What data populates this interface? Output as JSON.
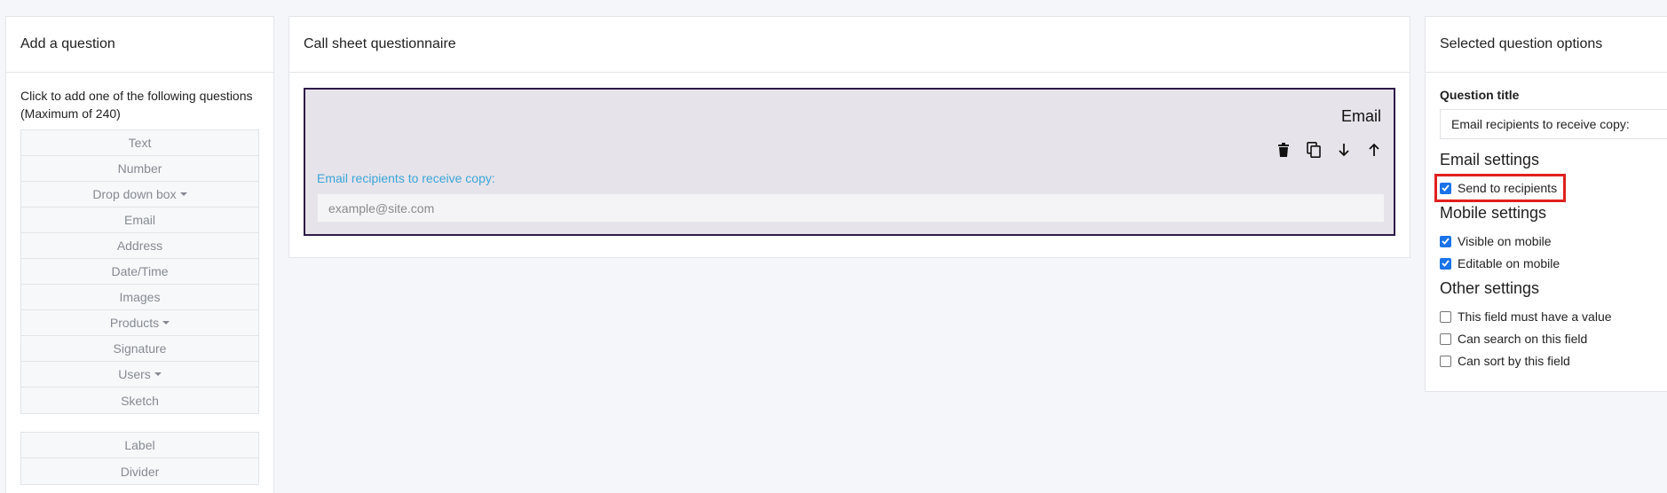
{
  "left_panel": {
    "title": "Add a question",
    "intro": "Click to add one of the following questions (Maximum of 240)",
    "questions": [
      {
        "label": "Text",
        "dropdown": false
      },
      {
        "label": "Number",
        "dropdown": false
      },
      {
        "label": "Drop down box",
        "dropdown": true
      },
      {
        "label": "Email",
        "dropdown": false
      },
      {
        "label": "Address",
        "dropdown": false
      },
      {
        "label": "Date/Time",
        "dropdown": false
      },
      {
        "label": "Images",
        "dropdown": false
      },
      {
        "label": "Products",
        "dropdown": true
      },
      {
        "label": "Signature",
        "dropdown": false
      },
      {
        "label": "Users",
        "dropdown": true
      },
      {
        "label": "Sketch",
        "dropdown": false
      }
    ],
    "extras": [
      {
        "label": "Label"
      },
      {
        "label": "Divider"
      }
    ]
  },
  "middle_panel": {
    "title": "Call sheet questionnaire",
    "question": {
      "type": "Email",
      "label": "Email recipients to receive copy:",
      "placeholder": "example@site.com",
      "tools": [
        "trash-icon",
        "copy-icon",
        "arrow-down-icon",
        "arrow-up-icon"
      ]
    }
  },
  "right_panel": {
    "title": "Selected question options",
    "question_title_label": "Question title",
    "question_title_value": "Email recipients to receive copy:",
    "email_settings": {
      "heading": "Email settings",
      "send_to_recipients": {
        "label": "Send to recipients",
        "checked": true
      }
    },
    "mobile_settings": {
      "heading": "Mobile settings",
      "visible": {
        "label": "Visible on mobile",
        "checked": true
      },
      "editable": {
        "label": "Editable on mobile",
        "checked": true
      }
    },
    "other_settings": {
      "heading": "Other settings",
      "required": {
        "label": "This field must have a value",
        "checked": false
      },
      "searchable": {
        "label": "Can search on this field",
        "checked": false
      },
      "sortable": {
        "label": "Can sort by this field",
        "checked": false
      }
    }
  },
  "colors": {
    "accent_border": "#2e1a47",
    "label_blue": "#3aa6d8",
    "checkbox_blue": "#1a73e8",
    "highlight_red": "#e0201f"
  }
}
